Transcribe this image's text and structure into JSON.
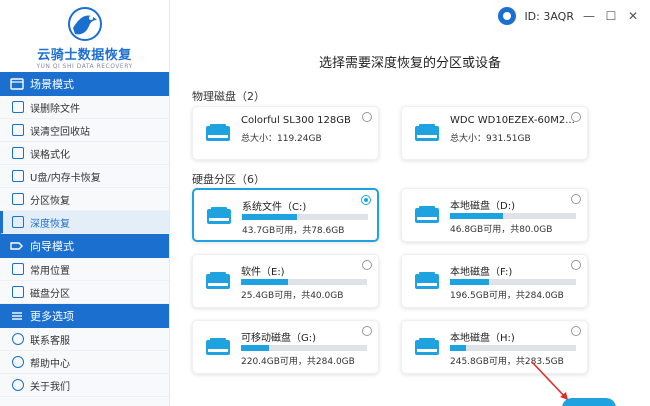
{
  "app": {
    "logo_title": "云骑士数据恢复",
    "logo_subtitle": "YUN QI SHI DATA RECOVERY"
  },
  "sidebar": {
    "sections": [
      {
        "title": "场景模式",
        "items": [
          {
            "label": "误删除文件",
            "icon": "trash-icon"
          },
          {
            "label": "误清空回收站",
            "icon": "recycle-bin-icon"
          },
          {
            "label": "误格式化",
            "icon": "format-icon"
          },
          {
            "label": "U盘/内存卡恢复",
            "icon": "usb-drive-icon"
          },
          {
            "label": "分区恢复",
            "icon": "partition-icon"
          },
          {
            "label": "深度恢复",
            "icon": "deep-recovery-icon",
            "active": true
          }
        ]
      },
      {
        "title": "向导模式",
        "items": [
          {
            "label": "常用位置",
            "icon": "folder-icon"
          },
          {
            "label": "磁盘分区",
            "icon": "disk-icon"
          }
        ]
      },
      {
        "title": "更多选项",
        "items": [
          {
            "label": "联系客服",
            "icon": "headset-icon"
          },
          {
            "label": "帮助中心",
            "icon": "help-icon"
          },
          {
            "label": "关于我们",
            "icon": "info-icon"
          }
        ]
      }
    ]
  },
  "header": {
    "id_label": "ID: 3AQR",
    "minimize": "—",
    "maximize": "☐",
    "close": "✕"
  },
  "main": {
    "title": "选择需要深度恢复的分区或设备",
    "physical_label": "物理磁盘（2）",
    "partition_label": "硬盘分区（6）",
    "physical_disks": [
      {
        "name": "Colorful SL300 128GB",
        "info": "总大小：119.24GB",
        "selected": false
      },
      {
        "name": "WDC WD10EZEX-60M2...",
        "info": "总大小：931.51GB",
        "selected": false
      }
    ],
    "partitions": [
      {
        "name": "系统文件（C:)",
        "info": "43.7GB可用，共78.6GB",
        "used_fraction": 0.44,
        "selected": true
      },
      {
        "name": "本地磁盘（D:)",
        "info": "46.8GB可用，共80.0GB",
        "used_fraction": 0.42,
        "selected": false
      },
      {
        "name": "软件（E:)",
        "info": "25.4GB可用，共40.0GB",
        "used_fraction": 0.37,
        "selected": false
      },
      {
        "name": "本地磁盘（F:)",
        "info": "196.5GB可用，共284.0GB",
        "used_fraction": 0.31,
        "selected": false
      },
      {
        "name": "可移动磁盘（G:)",
        "info": "220.4GB可用，共284.0GB",
        "used_fraction": 0.22,
        "selected": false
      },
      {
        "name": "本地磁盘（H:)",
        "info": "245.8GB可用，共283.5GB",
        "used_fraction": 0.13,
        "selected": false
      }
    ]
  },
  "colors": {
    "accent": "#1a6fcf",
    "bar": "#1ea3e0",
    "arrow": "#d9322a"
  }
}
